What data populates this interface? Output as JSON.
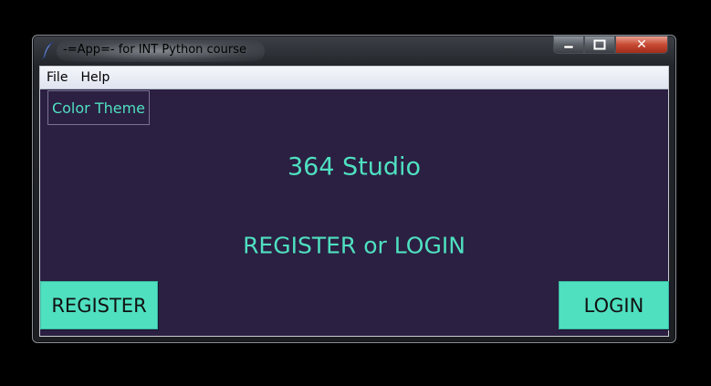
{
  "window": {
    "title": "-=App=- for INT Python course",
    "icon": "feather-icon",
    "controls": {
      "minimize": "minimize-icon",
      "maximize": "maximize-icon",
      "close": "close-icon",
      "close_glyph": "✕"
    }
  },
  "menubar": {
    "items": [
      {
        "label": "File"
      },
      {
        "label": "Help"
      }
    ]
  },
  "theme_button": {
    "label": "Color Theme"
  },
  "main": {
    "title": "364 Studio",
    "subtitle": "REGISTER or LOGIN"
  },
  "actions": {
    "register_label": "REGISTER",
    "login_label": "LOGIN"
  },
  "colors": {
    "background": "#2b1f42",
    "accent": "#4fe0c0",
    "button_text": "#111111"
  }
}
